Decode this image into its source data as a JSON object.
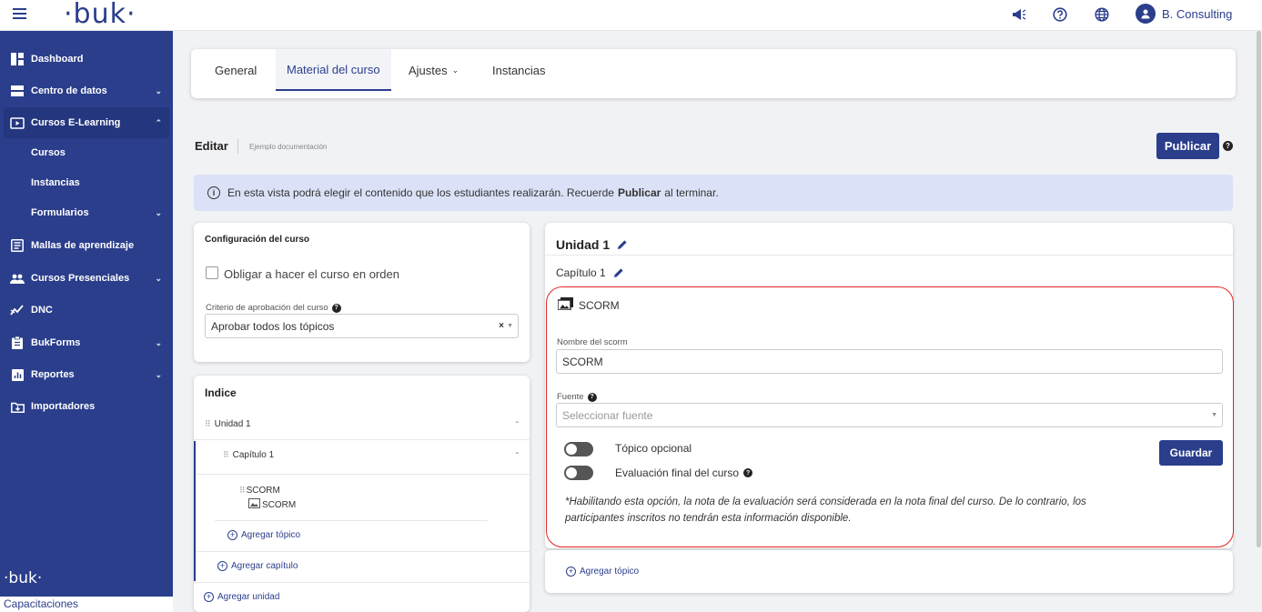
{
  "topbar": {
    "logo": "·buk·",
    "user_name": "B. Consulting"
  },
  "sidebar": {
    "items": [
      {
        "label": "Dashboard",
        "icon": "dashboard-icon"
      },
      {
        "label": "Centro de datos",
        "icon": "database-icon"
      },
      {
        "label": "Cursos E-Learning",
        "icon": "play-screen-icon"
      },
      {
        "label": "Cursos"
      },
      {
        "label": "Instancias"
      },
      {
        "label": "Formularios"
      },
      {
        "label": "Mallas de aprendizaje",
        "icon": "book-icon"
      },
      {
        "label": "Cursos Presenciales",
        "icon": "people-icon"
      },
      {
        "label": "DNC",
        "icon": "chart-icon"
      },
      {
        "label": "BukForms",
        "icon": "clipboard-icon"
      },
      {
        "label": "Reportes",
        "icon": "report-icon"
      },
      {
        "label": "Importadores",
        "icon": "import-icon"
      }
    ],
    "footer_brand": "·buk·",
    "footer_app": "Capacitaciones"
  },
  "tabs": {
    "general": "General",
    "material": "Material del curso",
    "ajustes": "Ajustes",
    "instancias": "Instancias"
  },
  "edit": {
    "title": "Editar",
    "subtitle": "Ejemplo documentación",
    "publish": "Publicar"
  },
  "banner": {
    "text_before": "En esta vista podrá elegir el contenido que los estudiantes realizarán. Recuerde",
    "bold": "Publicar",
    "text_after": "al terminar."
  },
  "config": {
    "title": "Configuración del curso",
    "checkbox_label": "Obligar a hacer el curso en orden",
    "criterion_label": "Criterio de aprobación del curso",
    "criterion_value": "Aprobar todos los tópicos"
  },
  "index": {
    "title": "Indice",
    "unit": "Unidad 1",
    "chapter": "Capítulo 1",
    "topic_name": "SCORM",
    "topic_type": "SCORM",
    "add_topic": "Agregar tópico",
    "add_chapter": "Agregar capítulo",
    "add_unit": "Agregar unidad"
  },
  "editor": {
    "unit_title": "Unidad 1",
    "chapter_title": "Capítulo 1",
    "scorm_header": "SCORM",
    "name_label": "Nombre del scorm",
    "name_value": "SCORM",
    "source_label": "Fuente",
    "source_placeholder": "Seleccionar fuente",
    "optional_label": "Tópico opcional",
    "final_eval_label": "Evaluación final del curso",
    "save": "Guardar",
    "note_line1": "*Habilitando esta opción, la nota de la evaluación será considerada en la nota final del curso. De lo contrario, los",
    "note_line2": "participantes inscritos no tendrán esta información disponible.",
    "add_topic": "Agregar tópico"
  },
  "colors": {
    "brand": "#2b3e8c",
    "highlight_border": "#e02424",
    "banner_bg": "#dbe2f7"
  }
}
